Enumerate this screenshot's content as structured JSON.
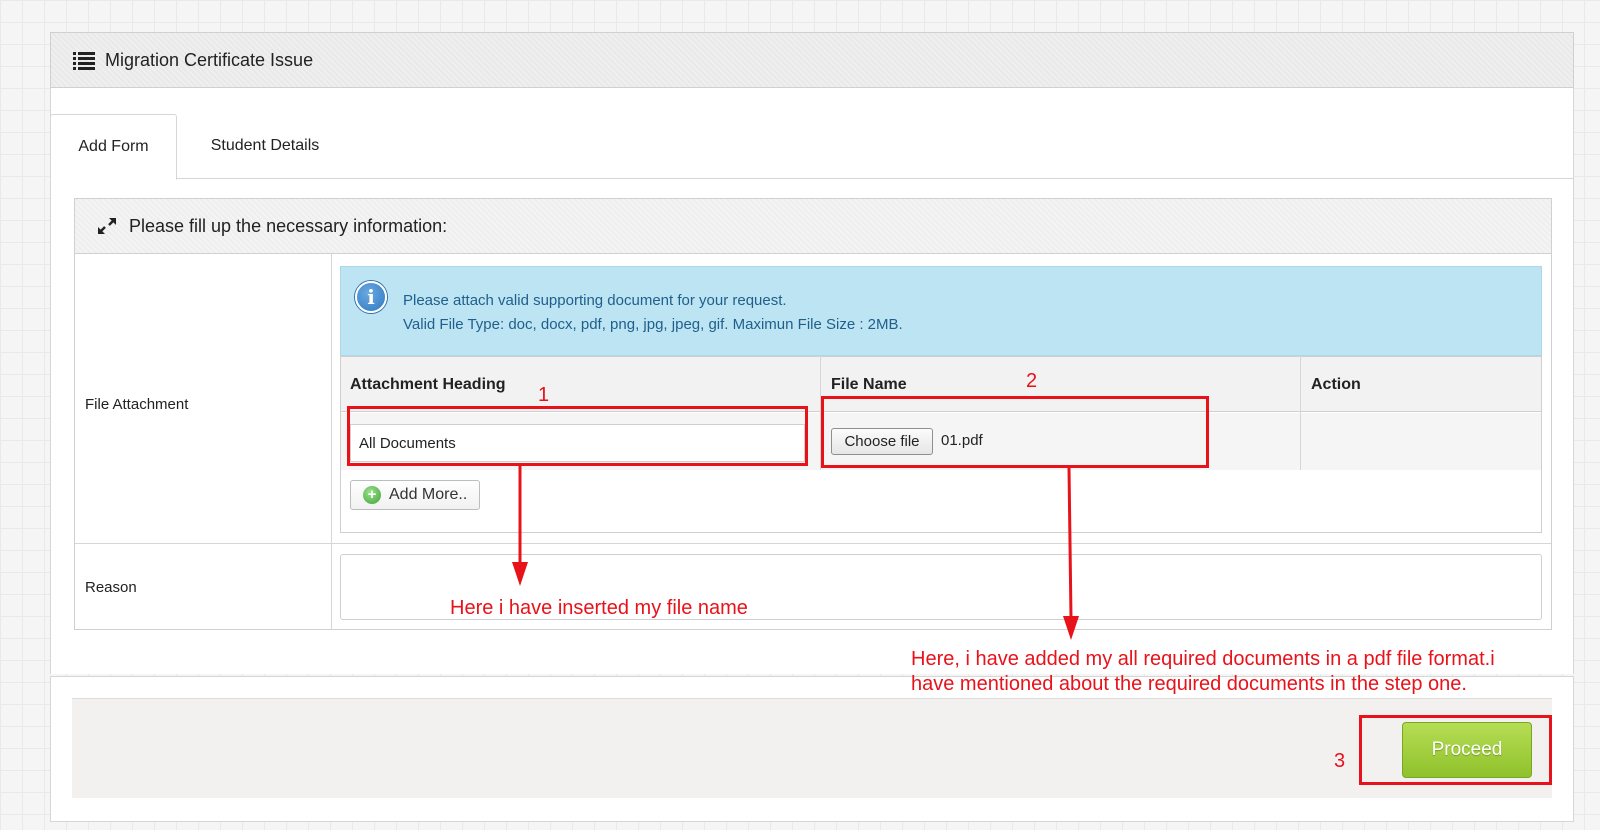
{
  "panel": {
    "title": "Migration Certificate Issue",
    "icon": "list-icon"
  },
  "tabs": [
    {
      "label": "Add Form",
      "active": true
    },
    {
      "label": "Student Details",
      "active": false
    }
  ],
  "section": {
    "title": "Please fill up the necessary information:",
    "icon": "expand-icon"
  },
  "file_attachment": {
    "label": "File Attachment",
    "alert": {
      "line1": "Please attach valid supporting document for your request.",
      "line2": "Valid File Type: doc, docx, pdf, png, jpg, jpeg, gif. Maximun File Size : 2MB."
    },
    "columns": [
      "Attachment Heading",
      "File Name",
      "Action"
    ],
    "row": {
      "heading_value": "All Documents",
      "choose_button": "Choose file",
      "file_name": "01.pdf"
    },
    "add_more_label": "Add More.."
  },
  "reason": {
    "label": "Reason",
    "value": ""
  },
  "proceed_label": "Proceed",
  "annotations": {
    "n1": "1",
    "n2": "2",
    "n3": "3",
    "note1": "Here i have inserted my file name",
    "note2_line1": "Here, i have added my all required documents in a pdf file format.i",
    "note2_line2": "have mentioned about the required documents in the step one.",
    "color": "#e8121a"
  },
  "colors": {
    "alert_bg": "#bde4f3",
    "alert_text": "#1f5f8b",
    "proceed_bg": "#9fcd3a"
  }
}
